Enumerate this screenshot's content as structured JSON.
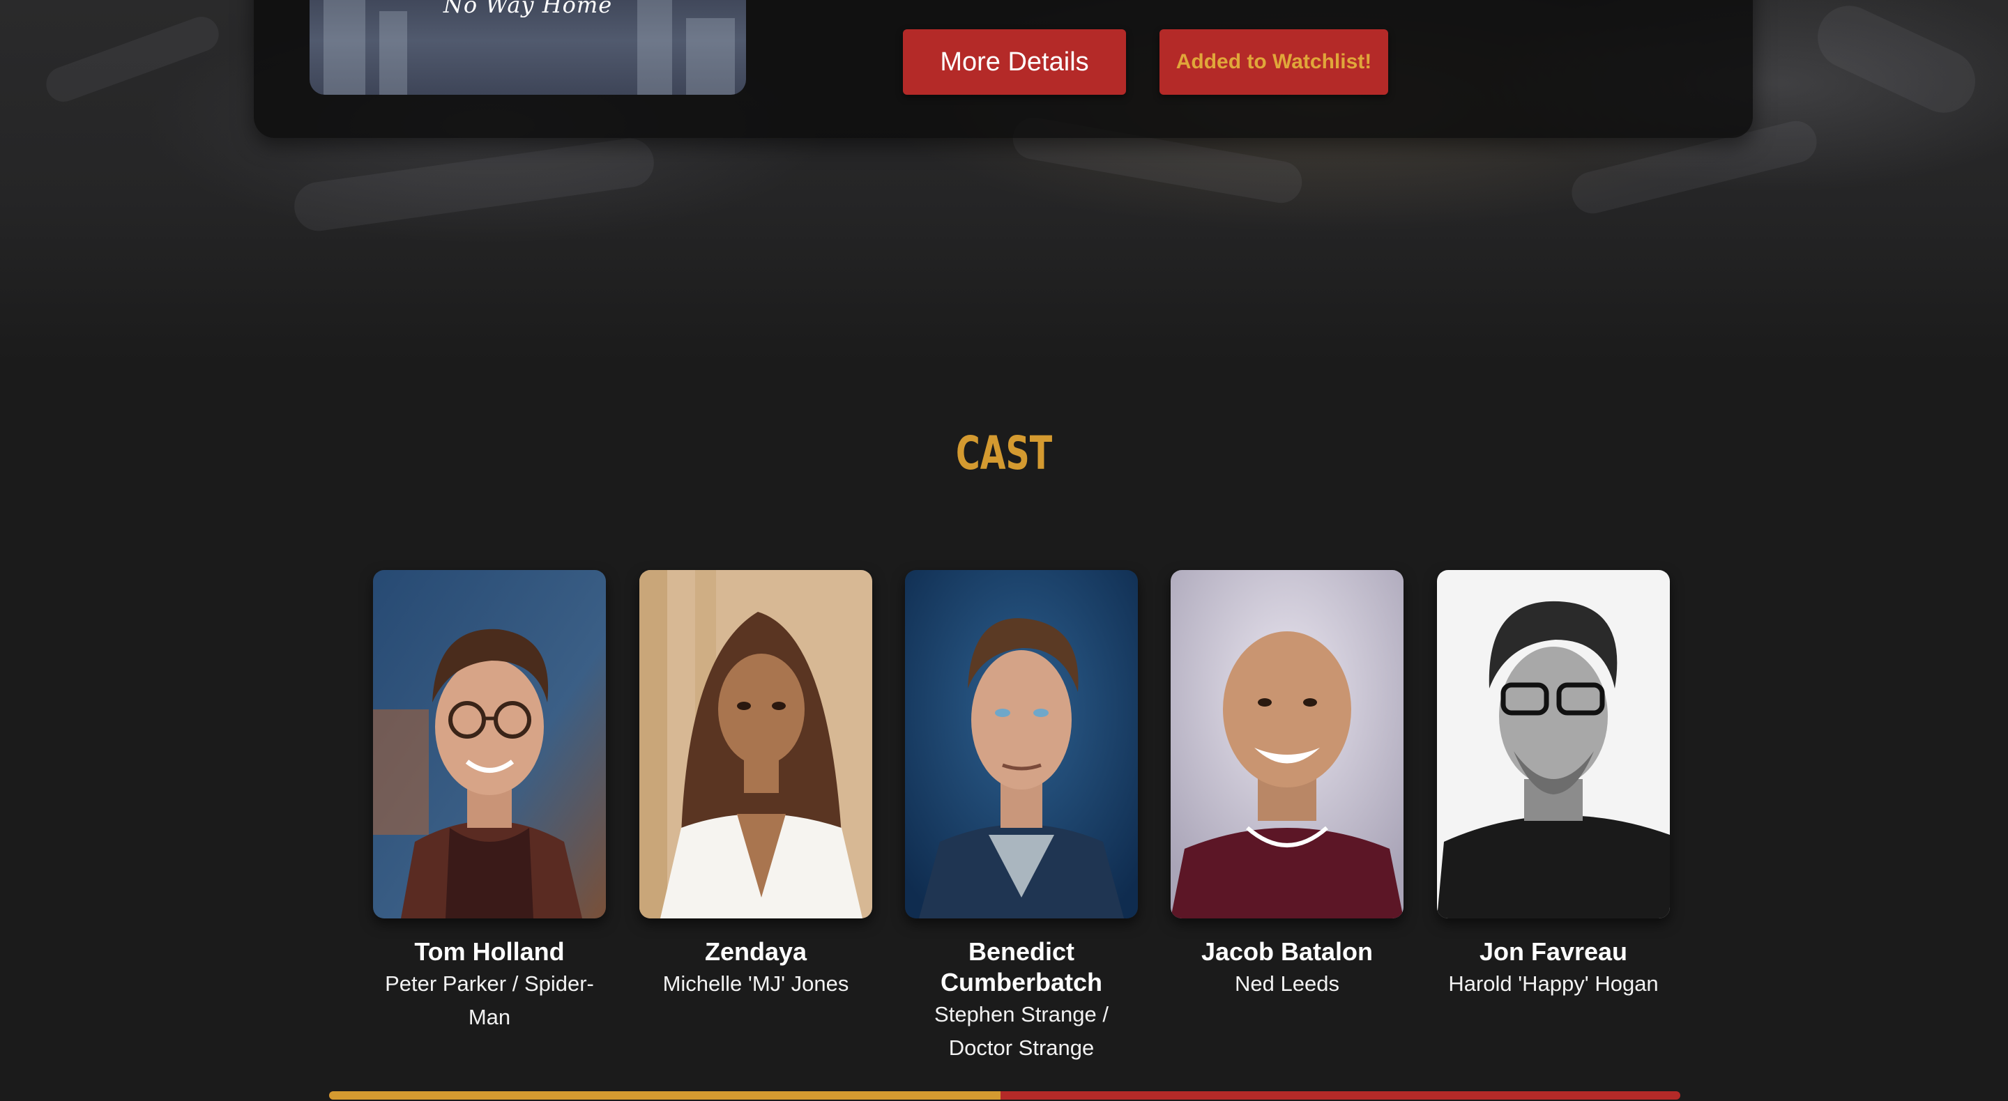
{
  "hero": {
    "poster_title": "No Way Home",
    "more_details_label": "More Details",
    "watchlist_label": "Added to Watchlist!"
  },
  "cast_section": {
    "title": "CAST",
    "members": [
      {
        "name": "Tom Holland",
        "role": "Peter Parker / Spider-Man"
      },
      {
        "name": "Zendaya",
        "role": "Michelle 'MJ' Jones"
      },
      {
        "name": "Benedict Cumberbatch",
        "role": "Stephen Strange / Doctor Strange"
      },
      {
        "name": "Jacob Batalon",
        "role": "Ned Leeds"
      },
      {
        "name": "Jon Favreau",
        "role": "Harold 'Happy' Hogan"
      }
    ]
  },
  "scroll_progress": {
    "fraction": 0.497
  },
  "colors": {
    "accent_gold": "#d49a30",
    "button_red": "#b42a28",
    "background": "#1b1b1b"
  }
}
